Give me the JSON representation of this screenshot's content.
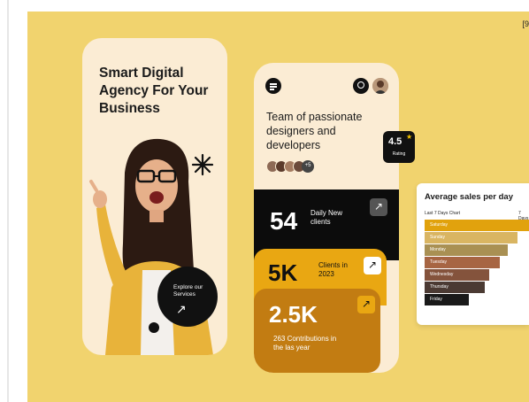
{
  "corner_tag": "[9",
  "hero": {
    "headline": "Smart Digital Agency For Your Business",
    "explore_label": "Explore our Services",
    "explore_arrow": "↗"
  },
  "phone": {
    "team_text": "Team of passionate designers and developers",
    "avatar_more": "+5",
    "stats": [
      {
        "value": "54",
        "label": "Daily New clients",
        "arrow": "↗"
      },
      {
        "value": "5K",
        "label": "Clients in 2023",
        "arrow": "↗"
      },
      {
        "value": "2.5K",
        "label": "263 Contributions in the las year",
        "arrow": "↗"
      }
    ]
  },
  "rating": {
    "value": "4.5",
    "label": "Rating"
  },
  "sales_card": {
    "title": "Average sales per day",
    "subtitle": "Last 7 Days Chart",
    "period": "7 Days",
    "bars": [
      {
        "day": "Saturday",
        "level": 1.0,
        "color": "#e1a20d"
      },
      {
        "day": "Sunday",
        "level": 0.89,
        "color": "#d9b562"
      },
      {
        "day": "Monday",
        "level": 0.8,
        "color": "#a99053"
      },
      {
        "day": "Tuesday",
        "level": 0.72,
        "color": "#a76543"
      },
      {
        "day": "Wednesday",
        "level": 0.62,
        "color": "#84533c"
      },
      {
        "day": "Thursday",
        "level": 0.58,
        "color": "#4b3a33"
      },
      {
        "day": "Friday",
        "level": 0.42,
        "color": "#1a1a1a"
      }
    ]
  },
  "colors": {
    "background": "#f1d36e",
    "card": "#fbecd4",
    "accent_orange": "#e9a712",
    "accent_brown": "#c27c12",
    "dark": "#0c0c0c"
  }
}
